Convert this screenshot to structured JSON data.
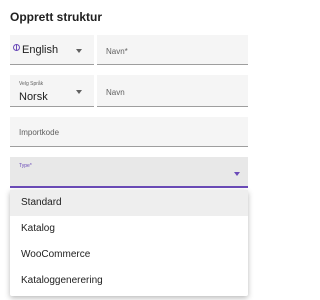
{
  "title": "Opprett struktur",
  "fields": {
    "language": {
      "value": "English"
    },
    "name_required": {
      "label": "Navn*"
    },
    "select_language": {
      "label": "Velg Språk",
      "value": "Norsk"
    },
    "name": {
      "label": "Navn"
    },
    "import_code": {
      "label": "Importkode"
    },
    "type": {
      "label": "Type*"
    }
  },
  "type_menu": {
    "options": [
      "Standard",
      "Katalog",
      "WooCommerce",
      "Kataloggenerering"
    ],
    "highlighted": "Standard"
  },
  "colors": {
    "accent": "#6b4bb8",
    "field_bg": "#f5f5f5",
    "active_field_bg": "#e8e8e8"
  }
}
